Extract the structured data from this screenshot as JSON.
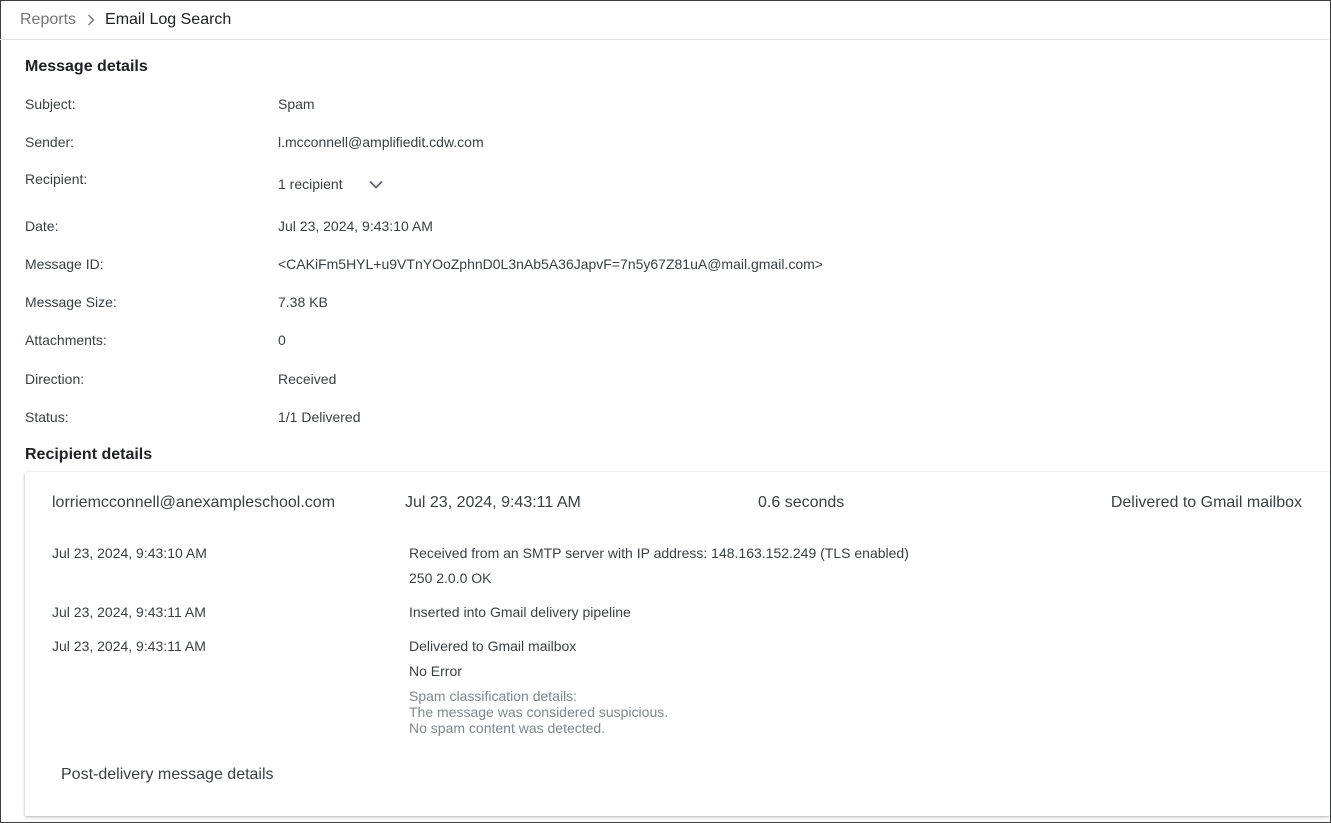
{
  "breadcrumb": {
    "parent": "Reports",
    "current": "Email Log Search"
  },
  "message_details": {
    "title": "Message details",
    "rows": [
      {
        "label": "Subject:",
        "value": "Spam"
      },
      {
        "label": "Sender:",
        "value": "l.mcconnell@amplifiedit.cdw.com"
      },
      {
        "label": "Recipient:",
        "value": "1 recipient"
      },
      {
        "label": "Date:",
        "value": "Jul 23, 2024, 9:43:10 AM"
      },
      {
        "label": "Message ID:",
        "value": "<CAKiFm5HYL+u9VTnYOoZphnD0L3nAb5A36JapvF=7n5y67Z81uA@mail.gmail.com>"
      },
      {
        "label": "Message Size:",
        "value": "7.38 KB"
      },
      {
        "label": "Attachments:",
        "value": "0"
      },
      {
        "label": "Direction:",
        "value": "Received"
      },
      {
        "label": "Status:",
        "value": "1/1 Delivered"
      }
    ]
  },
  "recipient_details": {
    "title": "Recipient details",
    "summary": {
      "email": "lorriemcconnell@anexampleschool.com",
      "date": "Jul 23, 2024, 9:43:11 AM",
      "duration": "0.6 seconds",
      "status": "Delivered to Gmail mailbox"
    },
    "events": [
      {
        "time": "Jul 23, 2024, 9:43:10 AM",
        "text": "Received from an SMTP server with IP address: 148.163.152.249 (TLS enabled)",
        "detail": "250 2.0.0 OK"
      },
      {
        "time": "Jul 23, 2024, 9:43:11 AM",
        "text": "Inserted into Gmail delivery pipeline"
      },
      {
        "time": "Jul 23, 2024, 9:43:11 AM",
        "text": "Delivered to Gmail mailbox",
        "detail": "No Error",
        "notes": [
          "Spam classification details:",
          "The message was considered suspicious.",
          "No spam content was detected."
        ]
      }
    ],
    "post_delivery_label": "Post-delivery message details"
  },
  "icons": {
    "breadcrumb_separator": "chevron-right-icon",
    "recipient_expand": "chevron-down-icon"
  }
}
